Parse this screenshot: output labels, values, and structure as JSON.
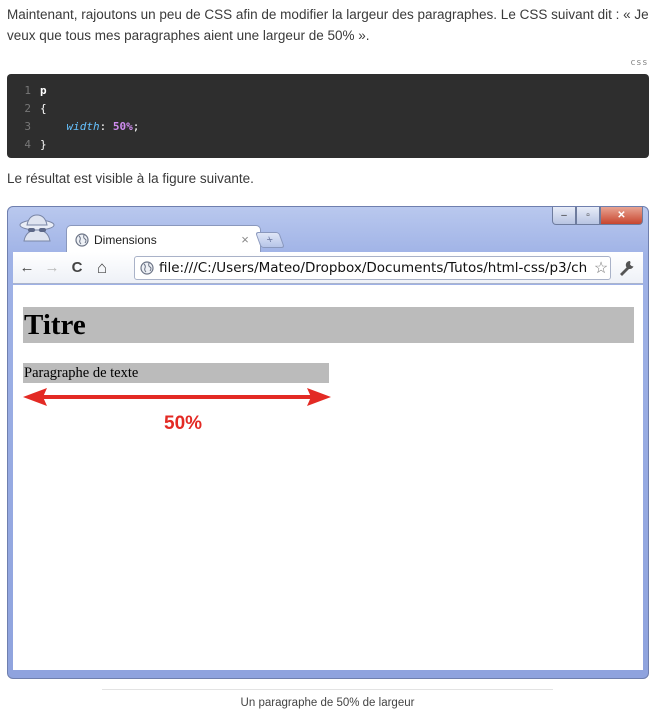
{
  "intro_text": "Maintenant, rajoutons un peu de CSS afin de modifier la largeur des paragraphes. Le CSS suivant dit : « Je veux que tous mes paragraphes aient une largeur de 50% ».",
  "code_block": {
    "language": "css",
    "line_numbers": [
      "1",
      "2",
      "3",
      "4"
    ],
    "selector": "p",
    "open_brace": "{",
    "property": "width",
    "colon": ":",
    "value": "50%",
    "semicolon": ";",
    "close_brace": "}"
  },
  "result_text": "Le résultat est visible à la figure suivante.",
  "browser": {
    "tab_title": "Dimensions",
    "tab_close": "×",
    "new_tab": "+",
    "url": "file:///C:/Users/Mateo/Dropbox/Documents/Tutos/html-css/p3/ch",
    "window_buttons": {
      "minimize": "–",
      "maximize": "▫",
      "close": "✕"
    },
    "nav": {
      "back": "←",
      "forward": "→",
      "reload": "C",
      "home": "⌂"
    },
    "page": {
      "heading": "Titre",
      "paragraph": "Paragraphe de texte",
      "annotation": "50%"
    }
  },
  "caption": "Un paragraphe de 50% de largeur",
  "colors": {
    "code_bg": "#2e2e2e",
    "annotation": "#e32a24",
    "block_bg": "#bbbbbb"
  }
}
